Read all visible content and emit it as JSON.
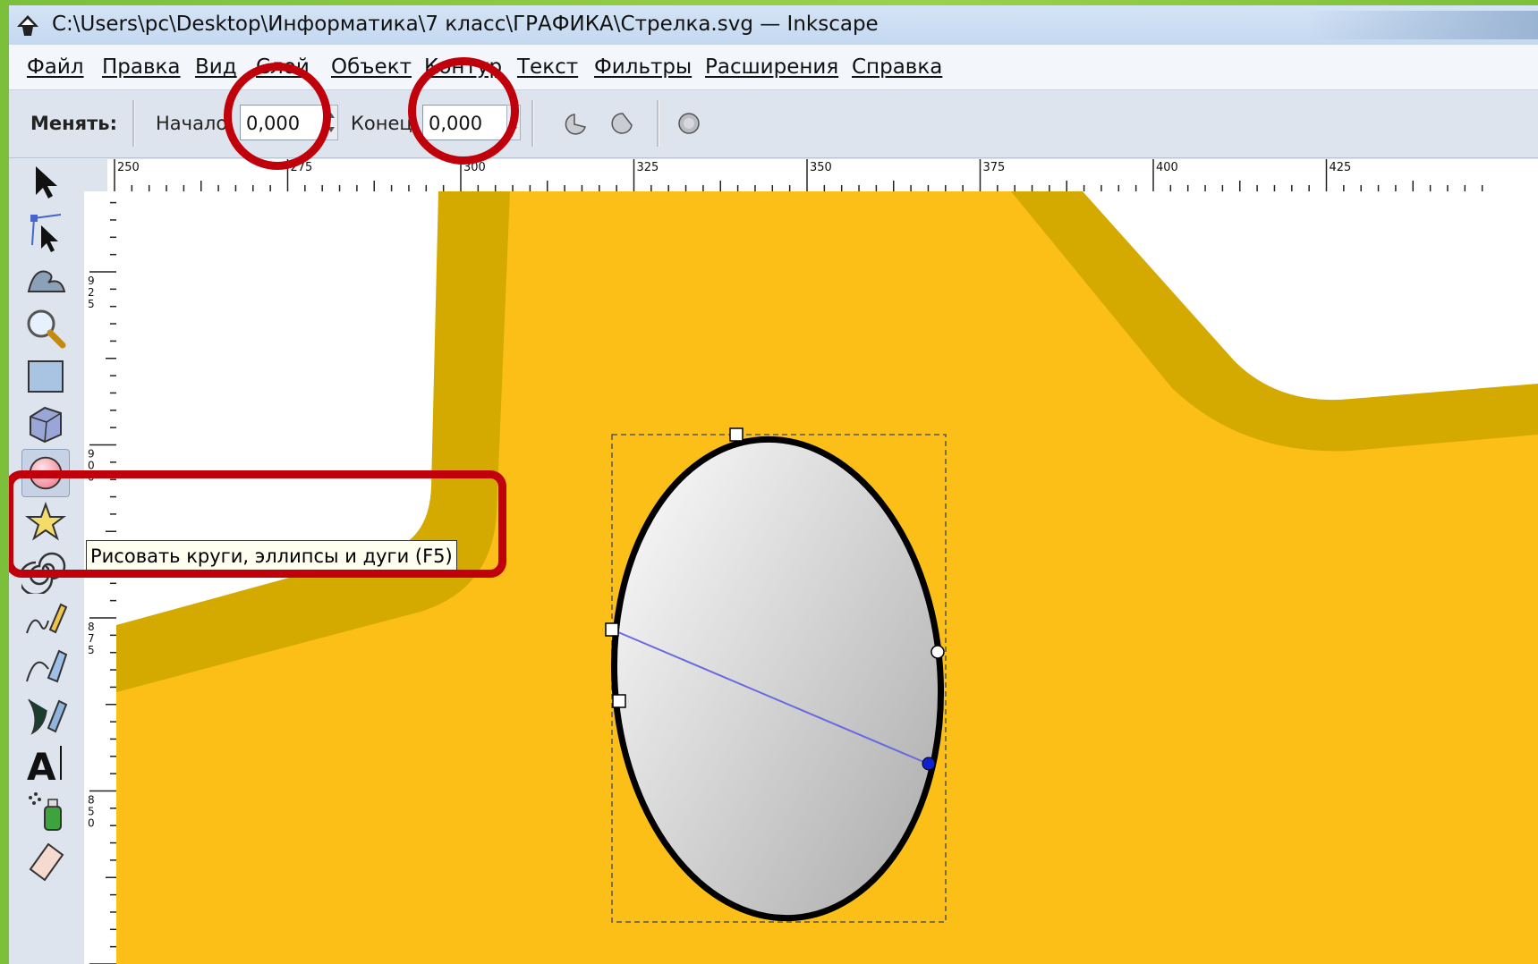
{
  "window": {
    "title": "C:\\Users\\pc\\Desktop\\Информатика\\7 класс\\ГРАФИКА\\Стрелка.svg — Inkscape"
  },
  "menu": [
    {
      "label": "Файл"
    },
    {
      "label": "Правка"
    },
    {
      "label": "Вид"
    },
    {
      "label": "Слой"
    },
    {
      "label": "Объект"
    },
    {
      "label": "Контур"
    },
    {
      "label": "Текст"
    },
    {
      "label": "Фильтры"
    },
    {
      "label": "Расширения"
    },
    {
      "label": "Справка"
    }
  ],
  "toolbar": {
    "change_label": "Менять:",
    "start_label": "Начало",
    "start_value": "0,000",
    "end_label": "Конец",
    "end_value": "0,000",
    "icons": [
      "arc-segment-icon",
      "arc-pie-icon",
      "whole-ellipse-icon"
    ]
  },
  "ruler": {
    "top_ticks": [
      "250",
      "275",
      "300",
      "325",
      "350",
      "375",
      "400",
      "425"
    ],
    "left_ticks": [
      "925",
      "900",
      "875",
      "850"
    ]
  },
  "tools": [
    {
      "icon": "selector-arrow-icon"
    },
    {
      "icon": "node-edit-icon"
    },
    {
      "icon": "tweak-wave-icon"
    },
    {
      "icon": "zoom-magnifier-icon"
    },
    {
      "icon": "rectangle-icon"
    },
    {
      "icon": "box-3d-icon"
    },
    {
      "icon": "ellipse-icon",
      "active": true
    },
    {
      "icon": "star-icon"
    },
    {
      "icon": "spiral-icon"
    },
    {
      "icon": "pencil-icon"
    },
    {
      "icon": "pen-bezier-icon"
    },
    {
      "icon": "calligraphy-icon"
    },
    {
      "icon": "text-icon"
    },
    {
      "icon": "spray-icon"
    },
    {
      "icon": "eraser-icon"
    }
  ],
  "tooltip": {
    "text": "Рисовать круги, эллипсы и дуги (F5)"
  },
  "colors": {
    "canvas_fill": "#fbbf17",
    "shape_band": "#d4aa00",
    "annotation_red": "#c0000a",
    "handle_blue": "#1020d0"
  }
}
